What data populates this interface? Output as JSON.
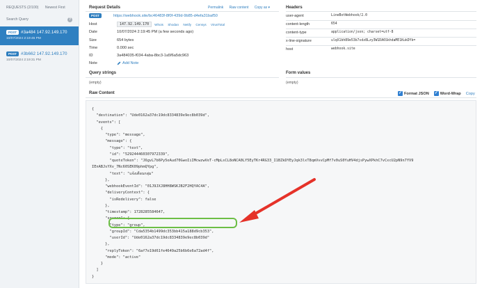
{
  "sidebar": {
    "requests_label": "REQUESTS (2/100)",
    "sort_label": "Newest First",
    "search_label": "Search Query",
    "help_icon": "?",
    "requests": [
      {
        "method": "POST",
        "id_ip": "#3a484 147.92.149.170",
        "time": "10/07/2024 2:19:45 PM",
        "active": true
      },
      {
        "method": "POST",
        "id_ip": "#3b662 147.92.149.170",
        "time": "10/07/2024 2:19:31 PM",
        "active": false
      }
    ]
  },
  "details": {
    "title": "Request Details",
    "tools": [
      "Permalink",
      "Raw content",
      "Copy as ▾"
    ],
    "method": "POST",
    "url": "https://webhook.site/bc46483f-8f0f-439d-9b85-d4efa31baf50",
    "host_label": "Host",
    "host_ip": "147.92.149.170",
    "host_links": [
      "Whois",
      "Shodan",
      "Netify",
      "Censys",
      "VirusTotal"
    ],
    "date_label": "Date",
    "date_value": "10/07/2024 2:19:45 PM (a few seconds ago)",
    "size_label": "Size",
    "size_value": "654 bytes",
    "time_label": "Time",
    "time_value": "0.000 sec",
    "id_label": "ID",
    "id_value": "3a484035-f034-4aba-8bc3-1a5f6a5dc963",
    "note_label": "Note",
    "note_action": "Add Note"
  },
  "headers": {
    "title": "Headers",
    "items": [
      {
        "key": "user-agent",
        "value": "LineBotWebhook/2.0"
      },
      {
        "key": "content-length",
        "value": "654"
      },
      {
        "key": "content-type",
        "value": "application/json; charset=utf-8"
      },
      {
        "key": "x-line-signature",
        "value": "ulqX1bh89e53b7sdz8Lzy3W1DA6SkhdaME1KukDYk="
      },
      {
        "key": "host",
        "value": "webhook.site"
      }
    ]
  },
  "query": {
    "title": "Query strings",
    "value": "(empty)"
  },
  "form": {
    "title": "Form values",
    "value": "(empty)"
  },
  "raw": {
    "title": "Raw Content",
    "format_json": "Format JSON",
    "word_wrap": "Word-Wrap",
    "copy": "Copy",
    "body": "{\n  \"destination\": \"Ude0162a37dc19dc8334839e9ec8b039d\",\n  \"events\": [\n    {\n      \"type\": \"message\",\n      \"message\": {\n        \"type\": \"text\",\n        \"id\": \"529244460307972339\",\n        \"quoteToken\": \"J6gvL7b6Py5eAud70GwoIiIMcwzwVeT-cMpLsCL8oNCA0LY5EyTKr4RG33_I1BZkDYEyJqk3lxT8qmVvvCpMf7v0uS0YuHV4djsPywXPkhC7vCxcU2pN9n7YV9\nIEnABJsYXv_7Nc60SEK09phmQYpg\",\n        \"text\": \"แจ้งเตือนกลุ่ม\"\n      },\n      \"webhookEventId\": \"01J9JXJ8HH8WSKJB2F2HQYAC4A\",\n      \"deliveryContext\": {\n        \"isRedelivery\": false\n      },\n      \"timestamp\": 1728285584647,\n      \"source\": {\n        \"type\": \"group\",\n        \"groupId\": \"Cda5354b1499dc353bb415a188d9cb353\",\n        \"userId\": \"Ude0162a37dc19dc8334839e9ec8b039d\"\n      },\n      \"replyToken\": \"6af7e19d61fe4649a25b6b6e6a72ad4f\",\n      \"mode\": \"active\"\n    }\n  ]\n}"
  }
}
